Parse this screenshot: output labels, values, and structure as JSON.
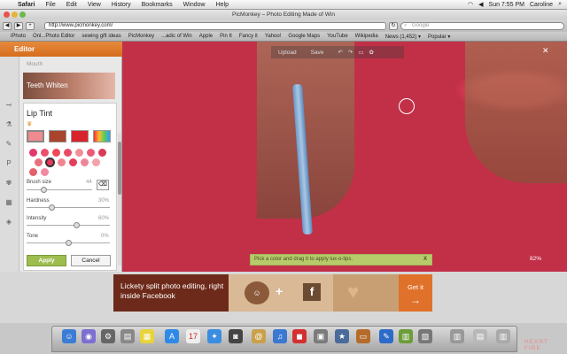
{
  "menubar": {
    "apple": "",
    "app": "Safari",
    "items": [
      "File",
      "Edit",
      "View",
      "History",
      "Bookmarks",
      "Window",
      "Help"
    ],
    "clock": "Sun 7:55 PM",
    "user": "Caroline"
  },
  "window": {
    "title": "PicMonkey – Photo Editing Made of Win"
  },
  "toolbar": {
    "url": "http://www.picmonkey.com/",
    "search_placeholder": "Google"
  },
  "bookmarks": [
    "iPhoto",
    "Onl...Photo Editor",
    "sewing gift ideas",
    "PicMonkey",
    "...adic of Win",
    "Apple",
    "Pin It",
    "Fancy it",
    "Yahoo!",
    "Google Maps",
    "YouTube",
    "Wikipedia",
    "News (1,452) ▾",
    "Popular ▾"
  ],
  "editor": {
    "header": "Editor",
    "section": "Mouth",
    "teeth_label": "Teeth Whiten",
    "tool_title": "Lip Tint",
    "controls": [
      {
        "label": "Brush size",
        "value": "44",
        "fraction": 0.25
      },
      {
        "label": "Hardness",
        "value": "30%",
        "fraction": 0.3
      },
      {
        "label": "Intensity",
        "value": "60%",
        "fraction": 0.6
      },
      {
        "label": "Tone",
        "value": "0%",
        "fraction": 0.5
      }
    ],
    "apply": "Apply",
    "cancel": "Cancel",
    "swatch_colors": [
      "#ef8a8f",
      "#a8442b",
      "#d7242c",
      "#7fcf5e"
    ],
    "dot_colors": [
      "#e2386a",
      "#ea4f6c",
      "#ee4a55",
      "#e84a64",
      "#f08f95",
      "#ec5a7a",
      "#d93a55",
      "#e86f7e",
      "#e6385b",
      "#f1848e",
      "#e23f5a",
      "#ee8597",
      "#f1a2ab",
      "#e3606e",
      "#f08aa1"
    ]
  },
  "photo_toolbar": {
    "upload": "Upload",
    "save": "Save"
  },
  "hint": {
    "text": "Pick a color and drag it to apply lux-o-lips.",
    "close": "X"
  },
  "zoom": "82%",
  "banner": {
    "text": "Lickety split photo editing, right inside Facebook",
    "plus": "+",
    "fb": "f",
    "cta": "Get it",
    "arrow": "→"
  },
  "dock": {
    "watermark": "HEART FIRE"
  }
}
